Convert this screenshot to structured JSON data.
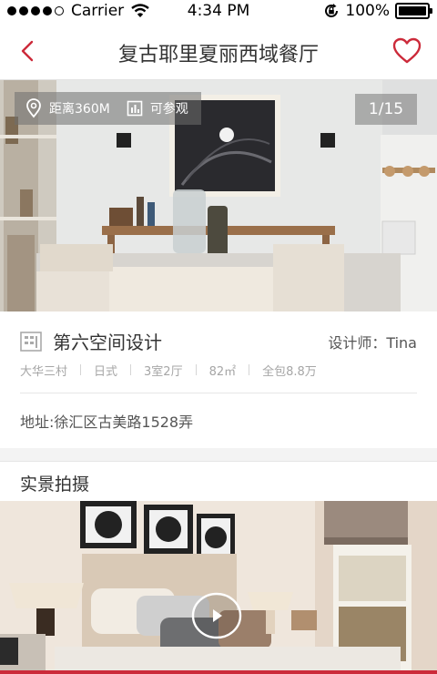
{
  "status_bar": {
    "carrier": "Carrier",
    "time": "4:34 PM",
    "battery": "100%"
  },
  "nav": {
    "title": "复古耶里夏丽西域餐厅",
    "back_icon": "chevron-left-icon",
    "favorite_icon": "heart-icon",
    "accent": "#cc2a3a"
  },
  "hero": {
    "distance": "距离360M",
    "visit": "可参观",
    "counter": "1/15"
  },
  "company": {
    "name": "第六空间设计",
    "designer": "设计师：Tina"
  },
  "tags": [
    "大华三村",
    "日式",
    "3室2厅",
    "82㎡",
    "全包8.8万"
  ],
  "address": "地址:徐汇区古美路1528弄",
  "section": {
    "title": "实景拍摄"
  }
}
